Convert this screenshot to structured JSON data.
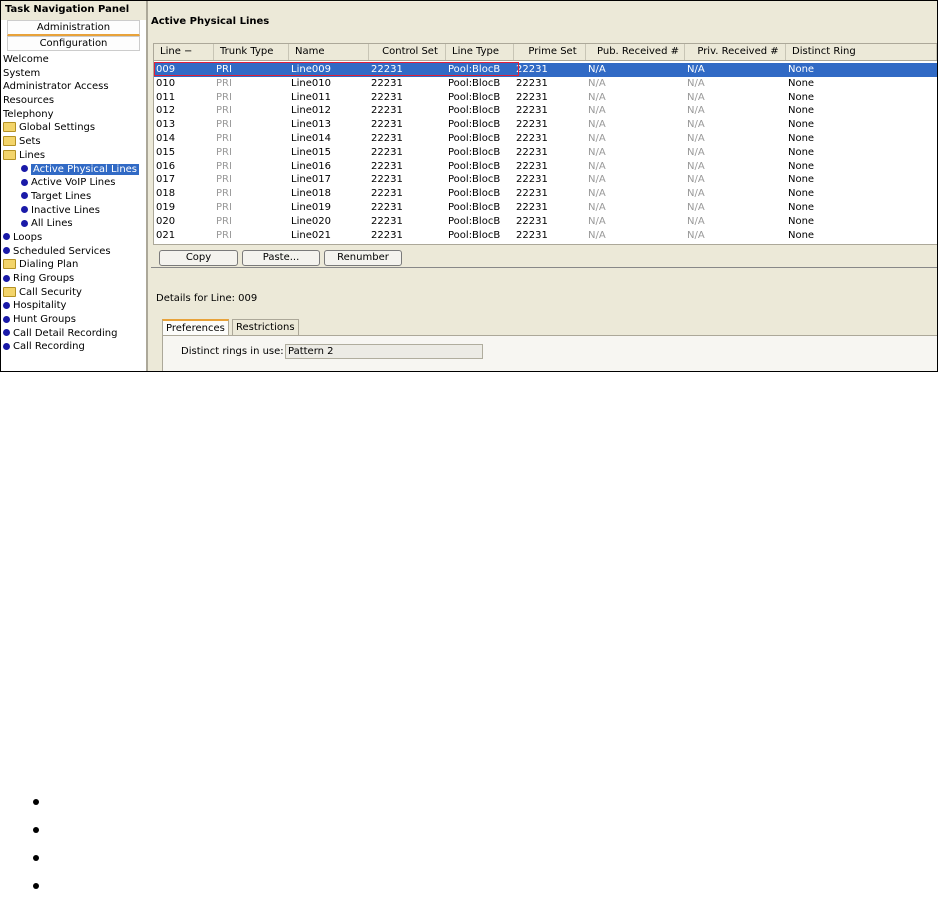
{
  "nav": {
    "title": "Task Navigation Panel",
    "tabs": [
      "Administration",
      "Configuration"
    ],
    "items": [
      {
        "label": "Welcome",
        "icon": "none",
        "level": 0
      },
      {
        "label": "System",
        "icon": "none",
        "level": 0
      },
      {
        "label": "Administrator Access",
        "icon": "none",
        "level": 0
      },
      {
        "label": "Resources",
        "icon": "none",
        "level": 0
      },
      {
        "label": "Telephony",
        "icon": "none",
        "level": 0
      },
      {
        "label": "Global Settings",
        "icon": "folder",
        "level": 0
      },
      {
        "label": "Sets",
        "icon": "folder",
        "level": 0
      },
      {
        "label": "Lines",
        "icon": "folder",
        "level": 0
      },
      {
        "label": "Active Physical Lines",
        "icon": "dot",
        "level": 1,
        "selected": true
      },
      {
        "label": "Active VoIP Lines",
        "icon": "dot",
        "level": 1
      },
      {
        "label": "Target Lines",
        "icon": "dot",
        "level": 1
      },
      {
        "label": "Inactive Lines",
        "icon": "dot",
        "level": 1
      },
      {
        "label": "All Lines",
        "icon": "dot",
        "level": 1
      },
      {
        "label": "Loops",
        "icon": "dot",
        "level": 0
      },
      {
        "label": "Scheduled Services",
        "icon": "dot",
        "level": 0
      },
      {
        "label": "Dialing Plan",
        "icon": "folder",
        "level": 0
      },
      {
        "label": "Ring Groups",
        "icon": "dot",
        "level": 0
      },
      {
        "label": "Call Security",
        "icon": "folder",
        "level": 0
      },
      {
        "label": "Hospitality",
        "icon": "dot",
        "level": 0
      },
      {
        "label": "Hunt Groups",
        "icon": "dot",
        "level": 0
      },
      {
        "label": "Call Detail Recording",
        "icon": "dot",
        "level": 0
      },
      {
        "label": "Call Recording",
        "icon": "dot",
        "level": 0
      }
    ]
  },
  "main": {
    "title": "Active Physical Lines",
    "columns": [
      "Line  −",
      "Trunk Type",
      "Name",
      "Control Set",
      "Line Type",
      "Prime Set",
      "Pub. Received #",
      "Priv. Received #",
      "Distinct Ring"
    ],
    "rows": [
      [
        "009",
        "PRI",
        "Line009",
        "22231",
        "Pool:BlocB",
        "22231",
        "N/A",
        "N/A",
        "None"
      ],
      [
        "010",
        "PRI",
        "Line010",
        "22231",
        "Pool:BlocB",
        "22231",
        "N/A",
        "N/A",
        "None"
      ],
      [
        "011",
        "PRI",
        "Line011",
        "22231",
        "Pool:BlocB",
        "22231",
        "N/A",
        "N/A",
        "None"
      ],
      [
        "012",
        "PRI",
        "Line012",
        "22231",
        "Pool:BlocB",
        "22231",
        "N/A",
        "N/A",
        "None"
      ],
      [
        "013",
        "PRI",
        "Line013",
        "22231",
        "Pool:BlocB",
        "22231",
        "N/A",
        "N/A",
        "None"
      ],
      [
        "014",
        "PRI",
        "Line014",
        "22231",
        "Pool:BlocB",
        "22231",
        "N/A",
        "N/A",
        "None"
      ],
      [
        "015",
        "PRI",
        "Line015",
        "22231",
        "Pool:BlocB",
        "22231",
        "N/A",
        "N/A",
        "None"
      ],
      [
        "016",
        "PRI",
        "Line016",
        "22231",
        "Pool:BlocB",
        "22231",
        "N/A",
        "N/A",
        "None"
      ],
      [
        "017",
        "PRI",
        "Line017",
        "22231",
        "Pool:BlocB",
        "22231",
        "N/A",
        "N/A",
        "None"
      ],
      [
        "018",
        "PRI",
        "Line018",
        "22231",
        "Pool:BlocB",
        "22231",
        "N/A",
        "N/A",
        "None"
      ],
      [
        "019",
        "PRI",
        "Line019",
        "22231",
        "Pool:BlocB",
        "22231",
        "N/A",
        "N/A",
        "None"
      ],
      [
        "020",
        "PRI",
        "Line020",
        "22231",
        "Pool:BlocB",
        "22231",
        "N/A",
        "N/A",
        "None"
      ],
      [
        "021",
        "PRI",
        "Line021",
        "22231",
        "Pool:BlocB",
        "22231",
        "N/A",
        "N/A",
        "None"
      ]
    ],
    "selected_row": 0,
    "buttons": {
      "copy": "Copy",
      "paste": "Paste...",
      "renumber": "Renumber"
    },
    "details": {
      "label": "Details for Line: 009",
      "tabs": [
        "Preferences",
        "Restrictions"
      ],
      "active_tab": "Preferences",
      "distinct_rings_label": "Distinct rings in use:",
      "distinct_rings_value": "Pattern 2"
    }
  },
  "colors": {
    "selection": "#316ac5",
    "highlight_border": "#e0203a",
    "tab_accent": "#e8a23a"
  }
}
